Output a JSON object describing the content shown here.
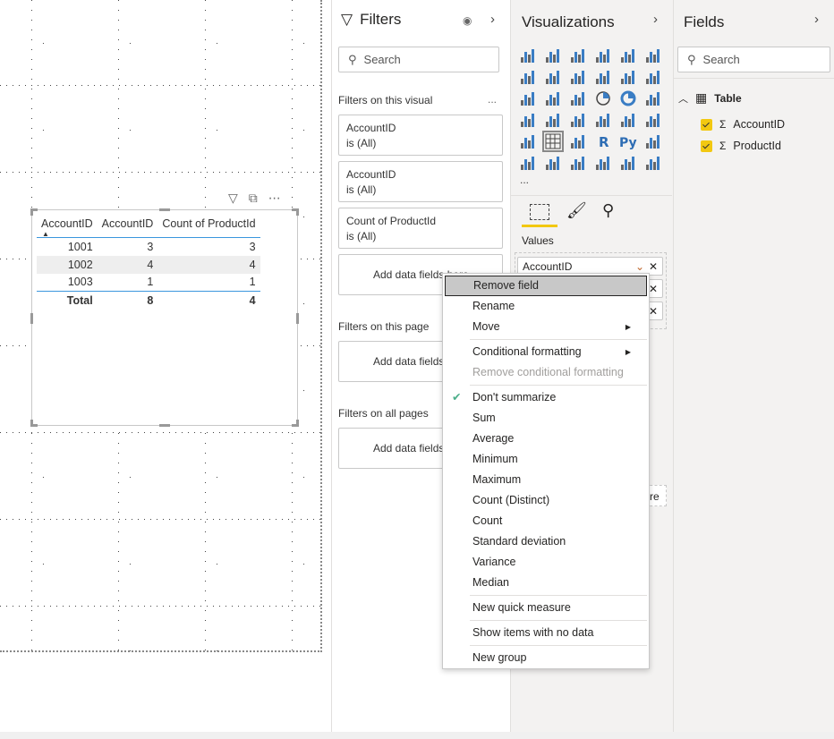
{
  "visual": {
    "columns": [
      "AccountID",
      "AccountID",
      "Count of ProductId"
    ],
    "rows": [
      [
        "1001",
        "3",
        "3"
      ],
      [
        "1002",
        "4",
        "4"
      ],
      [
        "1003",
        "1",
        "1"
      ]
    ],
    "total": [
      "Total",
      "8",
      "4"
    ]
  },
  "filters": {
    "title": "Filters",
    "search_placeholder": "Search",
    "on_visual": "Filters on this visual",
    "more": "...",
    "cards": [
      {
        "field": "AccountID",
        "state": "is (All)"
      },
      {
        "field": "AccountID",
        "state": "is (All)"
      },
      {
        "field": "Count of ProductId",
        "state": "is (All)"
      }
    ],
    "add_label": "Add data fields here",
    "on_page": "Filters on this page",
    "on_all": "Filters on all pages"
  },
  "visualizations": {
    "title": "Visualizations",
    "more": "...",
    "values_label": "Values",
    "wells": [
      "AccountID",
      "",
      ""
    ],
    "fragment": "re",
    "icons": [
      "stacked-bar",
      "stacked-column",
      "clustered-bar",
      "clustered-column",
      "100-bar",
      "100-column",
      "line",
      "area",
      "stacked-area",
      "line-column",
      "line-clustered-column",
      "ribbon",
      "waterfall",
      "funnel",
      "scatter",
      "pie",
      "donut",
      "treemap",
      "map",
      "filled-map",
      "gauge",
      "card",
      "multi-row-card",
      "kpi",
      "slicer",
      "table",
      "matrix",
      "r-visual",
      "python-visual",
      "key-influencers",
      "decomposition-tree",
      "qa",
      "smart-narrative",
      "arcgis",
      "power-apps",
      "power-automate"
    ]
  },
  "fields": {
    "title": "Fields",
    "search_placeholder": "Search",
    "table": "Table",
    "items": [
      "AccountID",
      "ProductId"
    ]
  },
  "menu": {
    "items": [
      "Remove field",
      "Rename",
      "Move",
      "Conditional formatting",
      "Remove conditional formatting",
      "Don't summarize",
      "Sum",
      "Average",
      "Minimum",
      "Maximum",
      "Count (Distinct)",
      "Count",
      "Standard deviation",
      "Variance",
      "Median",
      "New quick measure",
      "Show items with no data",
      "New group"
    ]
  },
  "colors": {
    "accent": "#f2c811",
    "table_line": "#3a96dd",
    "menu_hover": "#c8c8c8",
    "check": "#4caf8a"
  }
}
